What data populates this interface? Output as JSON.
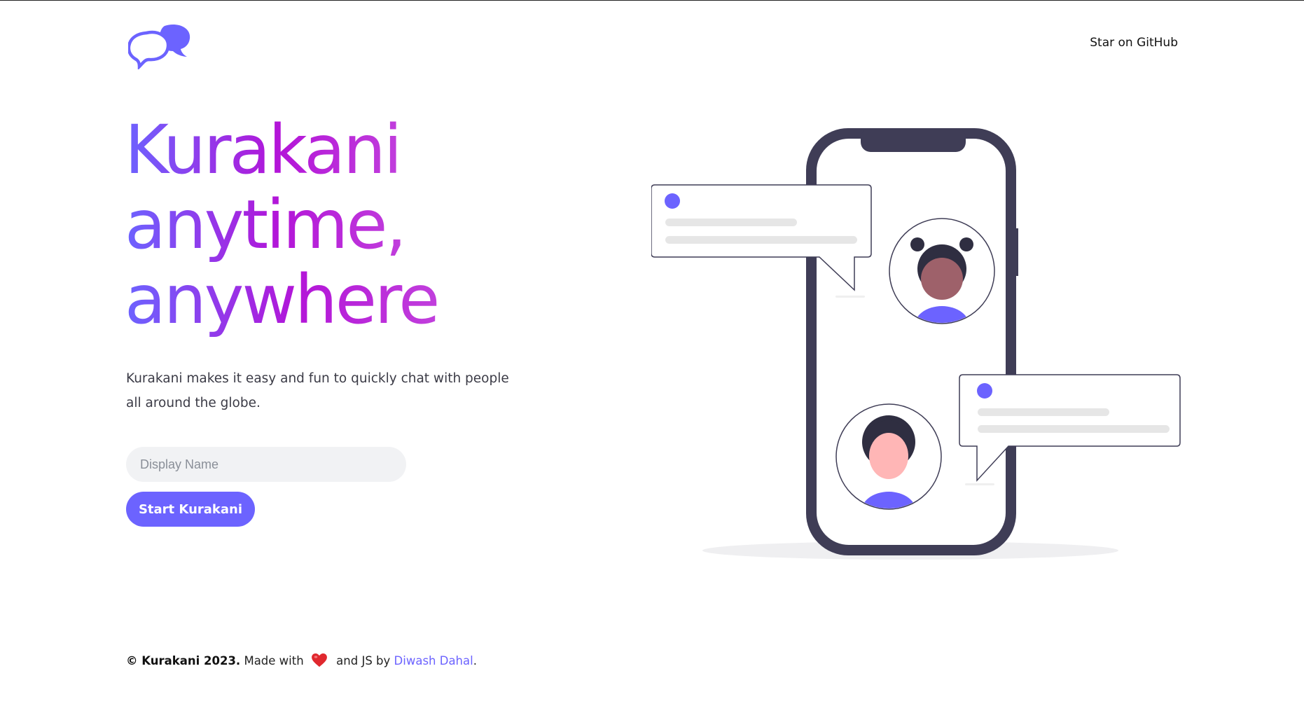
{
  "header": {
    "logo": {
      "icon": "chat-bubbles-icon",
      "color": "#6c63ff"
    },
    "github_link": "Star on GitHub"
  },
  "hero": {
    "title_lines": [
      "Kurakani",
      "anytime,",
      "anywhere"
    ],
    "gradient": [
      "#6c63ff",
      "#b315d8",
      "#c13fdc"
    ],
    "description": "Kurakani makes it easy and fun to quickly chat with people all around the globe."
  },
  "form": {
    "display_name": {
      "value": "",
      "placeholder": "Display Name"
    },
    "start_button": "Start Kurakani"
  },
  "illustration": {
    "phone_color": "#3f3d56",
    "accent": "#6c63ff",
    "avatars": [
      "woman-avatar",
      "man-avatar"
    ]
  },
  "footer": {
    "copyright": "© Kurakani 2023.",
    "made_with": " Made with ",
    "heart_icon": "heart-icon",
    "and_js_by": " and JS by ",
    "author": "Diwash Dahal",
    "period": "."
  },
  "colors": {
    "brand": "#6c63ff",
    "text": "#3b3b46"
  }
}
